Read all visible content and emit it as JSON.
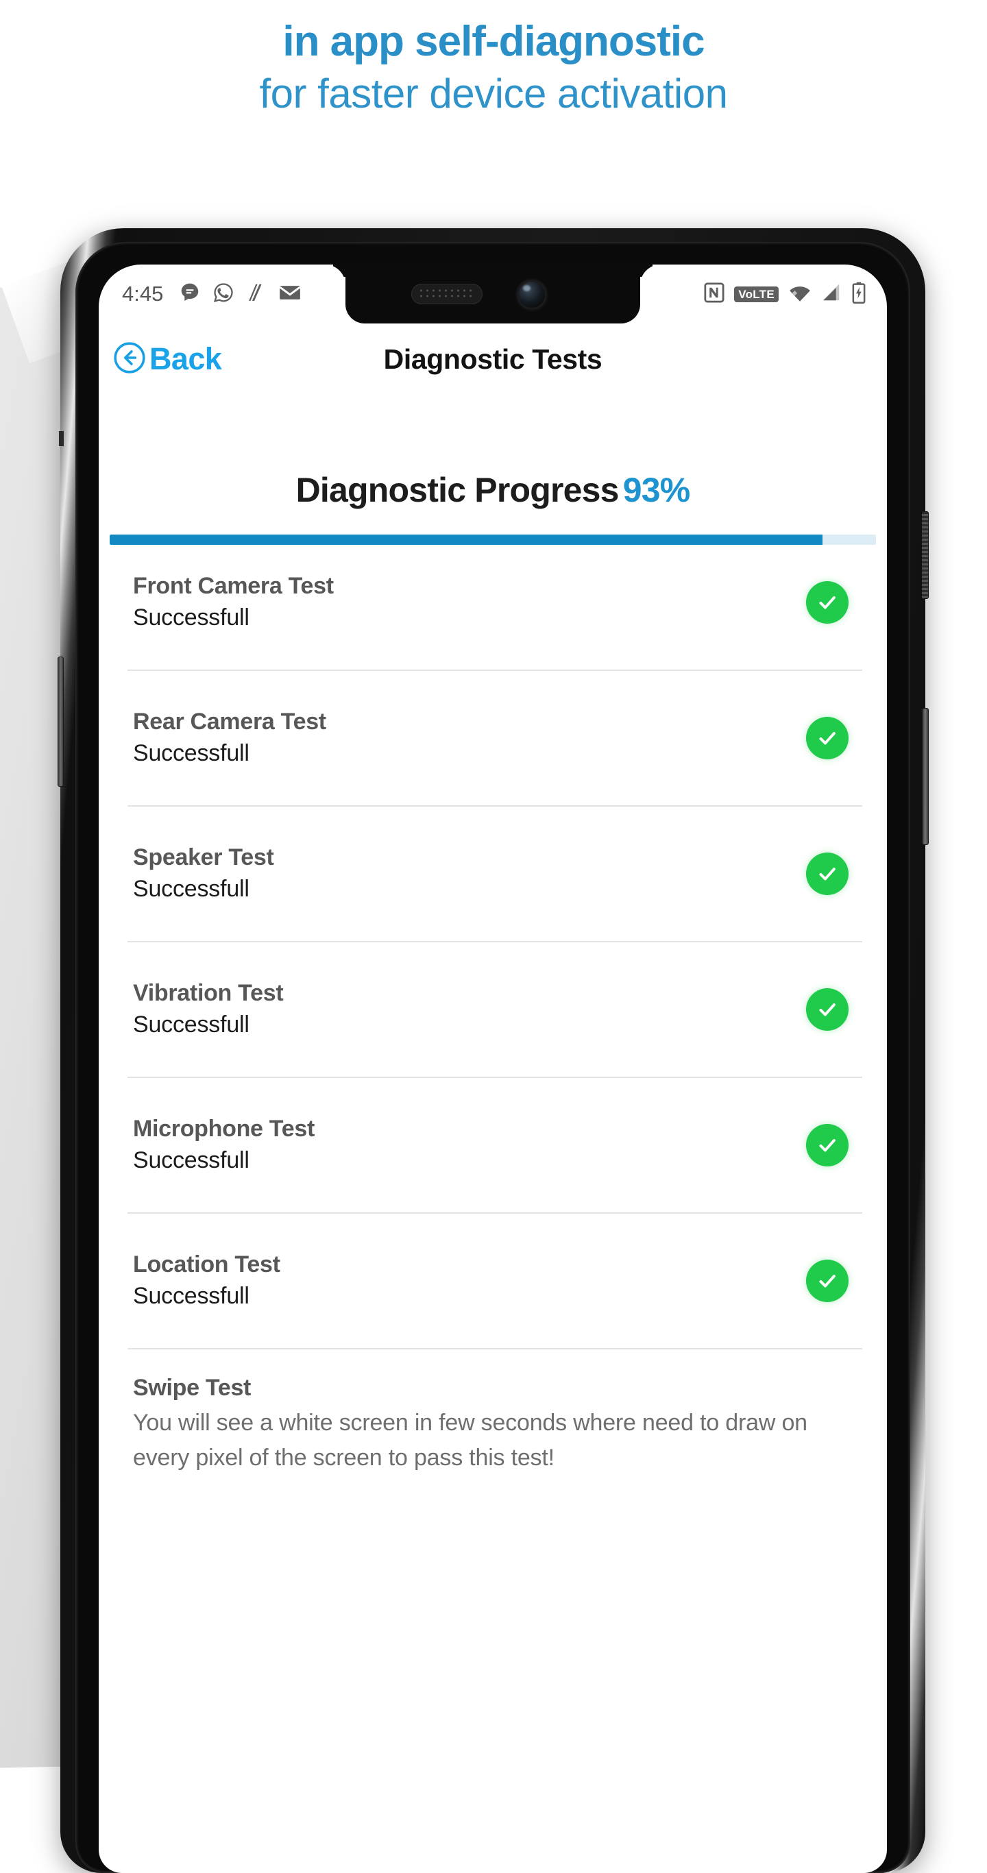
{
  "promo": {
    "line1": "in app self-diagnostic",
    "line2": "for faster device activation",
    "accent_color": "#2a8fc7"
  },
  "status_bar": {
    "time": "4:45",
    "left_icons": [
      "messages-icon",
      "whatsapp-icon",
      "nike-icon",
      "email-icon"
    ],
    "right_icons": [
      "nfc-icon",
      "volte-badge",
      "wifi-icon",
      "cellular-signal-icon",
      "battery-charging-icon"
    ],
    "volte_label": "VoLTE"
  },
  "app_bar": {
    "back_label": "Back",
    "title": "Diagnostic Tests"
  },
  "progress": {
    "title": "Diagnostic Progress",
    "percent_label": "93%",
    "percent_value": 93,
    "fill_color": "#1289c2",
    "track_color": "#dcedf6"
  },
  "tests": [
    {
      "name": "Front Camera Test",
      "status": "Successfull",
      "passed": true
    },
    {
      "name": "Rear Camera Test",
      "status": "Successfull",
      "passed": true
    },
    {
      "name": "Speaker Test",
      "status": "Successfull",
      "passed": true
    },
    {
      "name": "Vibration Test",
      "status": "Successfull",
      "passed": true
    },
    {
      "name": "Microphone Test",
      "status": "Successfull",
      "passed": true
    },
    {
      "name": "Location Test",
      "status": "Successfull",
      "passed": true
    },
    {
      "name": "Swipe Test",
      "status": "You will see a white screen in few seconds where need to draw on every pixel of the screen to pass this test!",
      "passed": false
    }
  ],
  "colors": {
    "success_green": "#20cb4b",
    "link_blue": "#1aa3e8",
    "accent_blue": "#1d93cf"
  }
}
